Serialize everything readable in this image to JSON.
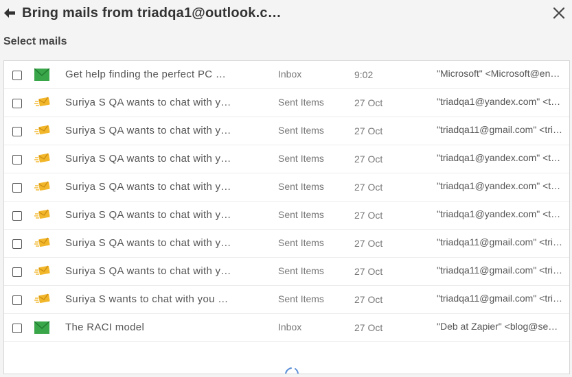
{
  "header": {
    "title": "Bring mails from triadqa1@outlook.c…",
    "back_icon": "arrow-left-icon",
    "close_icon": "close-icon"
  },
  "section_label": "Select mails",
  "colors": {
    "inbox_icon": "#3aa64a",
    "sent_icon": "#f2b62b"
  },
  "mails": [
    {
      "icon": "inbox-mail-icon",
      "subject": "Get help finding the perfect PC …",
      "folder": "Inbox",
      "date": "9:02",
      "sender": "\"Microsoft\" <Microsoft@en…"
    },
    {
      "icon": "sent-mail-icon",
      "subject": "Suriya S QA wants to chat with y…",
      "folder": "Sent Items",
      "date": "27 Oct",
      "sender": "\"triadqa1@yandex.com\" <t…"
    },
    {
      "icon": "sent-mail-icon",
      "subject": "Suriya S QA wants to chat with y…",
      "folder": "Sent Items",
      "date": "27 Oct",
      "sender": "\"triadqa11@gmail.com\" <tri…"
    },
    {
      "icon": "sent-mail-icon",
      "subject": "Suriya S QA wants to chat with y…",
      "folder": "Sent Items",
      "date": "27 Oct",
      "sender": "\"triadqa1@yandex.com\" <t…"
    },
    {
      "icon": "sent-mail-icon",
      "subject": "Suriya S QA wants to chat with y…",
      "folder": "Sent Items",
      "date": "27 Oct",
      "sender": "\"triadqa1@yandex.com\" <t…"
    },
    {
      "icon": "sent-mail-icon",
      "subject": "Suriya S QA wants to chat with y…",
      "folder": "Sent Items",
      "date": "27 Oct",
      "sender": "\"triadqa1@yandex.com\" <t…"
    },
    {
      "icon": "sent-mail-icon",
      "subject": "Suriya S QA wants to chat with y…",
      "folder": "Sent Items",
      "date": "27 Oct",
      "sender": "\"triadqa11@gmail.com\" <tri…"
    },
    {
      "icon": "sent-mail-icon",
      "subject": "Suriya S QA wants to chat with y…",
      "folder": "Sent Items",
      "date": "27 Oct",
      "sender": "\"triadqa11@gmail.com\" <tri…"
    },
    {
      "icon": "sent-mail-icon",
      "subject": "Suriya S wants to chat with you …",
      "folder": "Sent Items",
      "date": "27 Oct",
      "sender": "\"triadqa11@gmail.com\" <tri…"
    },
    {
      "icon": "inbox-mail-icon",
      "subject": "The RACI model",
      "folder": "Inbox",
      "date": "27 Oct",
      "sender": "\"Deb at Zapier\" <blog@se…"
    }
  ]
}
